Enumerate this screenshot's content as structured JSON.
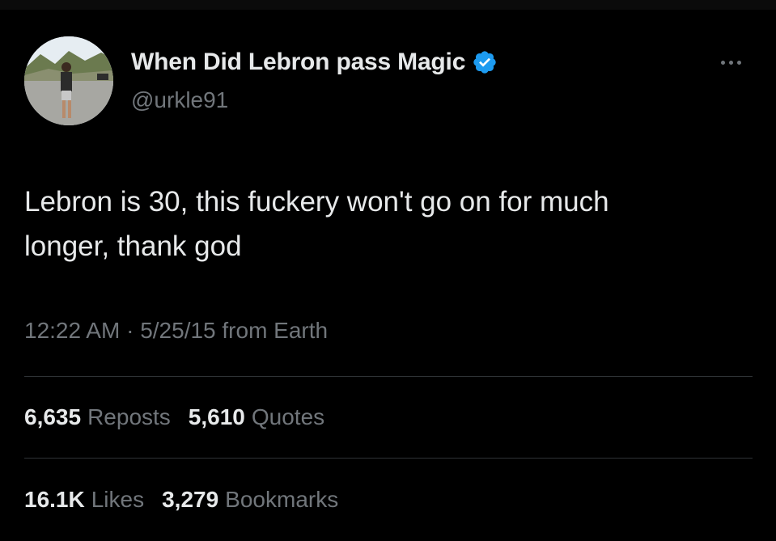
{
  "tweet": {
    "display_name": "When Did Lebron pass Magic",
    "handle": "@urkle91",
    "verified_icon": "verified-badge-icon",
    "more_icon": "more-options-icon",
    "text": "Lebron is 30, this fuckery won't go on for much\nlonger, thank god",
    "time": "12:22 AM",
    "separator": "·",
    "date": "5/25/15",
    "source": "from Earth",
    "stats_row1": [
      {
        "value": "6,635",
        "label": "Reposts"
      },
      {
        "value": "5,610",
        "label": "Quotes"
      }
    ],
    "stats_row2": [
      {
        "value": "16.1K",
        "label": "Likes"
      },
      {
        "value": "3,279",
        "label": "Bookmarks"
      }
    ]
  },
  "colors": {
    "background": "#000000",
    "primary_text": "#e7e9ea",
    "secondary_text": "#71767b",
    "divider": "#2f3336",
    "verified_blue": "#1d9bf0"
  }
}
